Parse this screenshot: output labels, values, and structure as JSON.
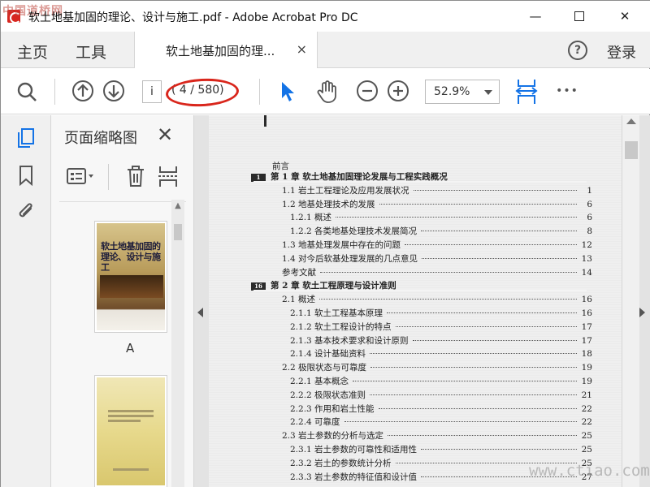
{
  "window": {
    "title": "软土地基加固的理论、设计与施工.pdf - Adobe Acrobat Pro DC",
    "minimize_glyph": "—",
    "close_glyph": "✕",
    "watermark_top_left": "中国道桥网"
  },
  "nav": {
    "home": "主页",
    "tools": "工具",
    "doc_tab_label": "软土地基加固的理...",
    "doc_tab_close": "×",
    "help_glyph": "?",
    "login": "登录"
  },
  "toolbar": {
    "page_input_value": "i",
    "page_count": "( 4 / 580)",
    "zoom_value": "52.9%",
    "more_glyph": "•••"
  },
  "panel": {
    "title": "页面缩略图",
    "close_glyph": "✕",
    "thumb1_label": "A",
    "cover_title_line1": "软土地基加固的",
    "cover_title_line2": "理论、设计与施工"
  },
  "document": {
    "foreword": "前言",
    "toc": [
      {
        "marker": "1",
        "title": "第 1 章    软土地基加固理论发展与工程实践概况",
        "page": "",
        "chapter": true
      },
      {
        "title": "1.1    岩土工程理论及应用发展状况",
        "page": "1"
      },
      {
        "title": "1.2    地基处理技术的发展",
        "page": "6"
      },
      {
        "title": "1.2.1    概述",
        "page": "6"
      },
      {
        "title": "1.2.2    各类地基处理技术发展简况",
        "page": "8"
      },
      {
        "title": "1.3    地基处理发展中存在的问题",
        "page": "12"
      },
      {
        "title": "1.4    对今后软基处理发展的几点意见",
        "page": "13"
      },
      {
        "title": "参考文献",
        "page": "14"
      },
      {
        "marker": "16",
        "title": "第 2 章    软土工程原理与设计准则",
        "page": "",
        "chapter": true
      },
      {
        "title": "2.1    概述",
        "page": "16"
      },
      {
        "title": "2.1.1    软土工程基本原理",
        "page": "16"
      },
      {
        "title": "2.1.2    软土工程设计的特点",
        "page": "17"
      },
      {
        "title": "2.1.3    基本技术要求和设计原则",
        "page": "17"
      },
      {
        "title": "2.1.4    设计基础资料",
        "page": "18"
      },
      {
        "title": "2.2    极限状态与可靠度",
        "page": "19"
      },
      {
        "title": "2.2.1    基本概念",
        "page": "19"
      },
      {
        "title": "2.2.2    极限状态准则",
        "page": "21"
      },
      {
        "title": "2.2.3    作用和岩土性能",
        "page": "22"
      },
      {
        "title": "2.2.4    可靠度",
        "page": "22"
      },
      {
        "title": "2.3    岩土参数的分析与选定",
        "page": "25"
      },
      {
        "title": "2.3.1    岩土参数的可靠性和适用性",
        "page": "25"
      },
      {
        "title": "2.3.2    岩土的参数统计分析",
        "page": "25"
      },
      {
        "title": "2.3.3    岩土参数的特征值和设计值",
        "page": "27"
      }
    ],
    "watermark_bottom_right": "www.ctiao.com"
  }
}
